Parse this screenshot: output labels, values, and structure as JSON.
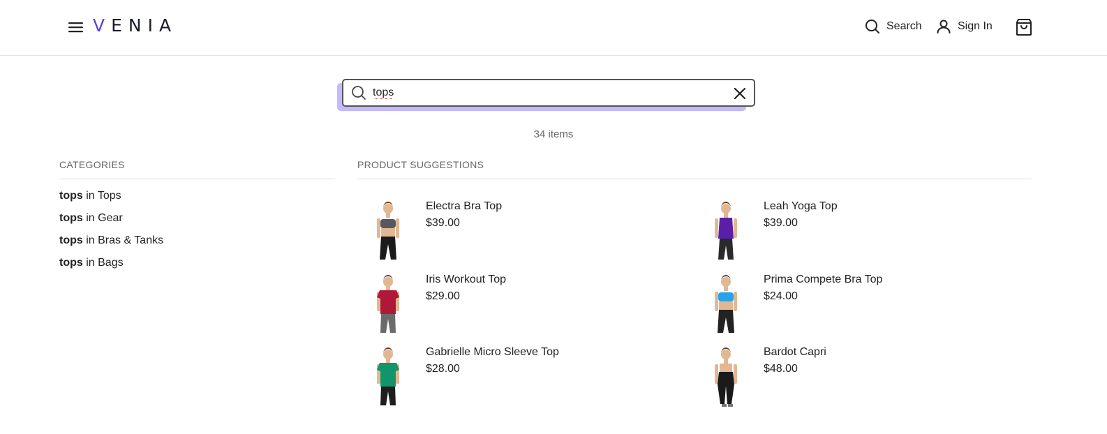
{
  "header": {
    "logo_first": "V",
    "logo_rest": "ENIA",
    "search_label": "Search",
    "signin_label": "Sign In"
  },
  "search": {
    "value": "tops",
    "placeholder": ""
  },
  "results": {
    "count_text": "34 items"
  },
  "categories": {
    "title": "CATEGORIES",
    "items": [
      {
        "term": "tops",
        "rest": " in Tops"
      },
      {
        "term": "tops",
        "rest": " in Gear"
      },
      {
        "term": "tops",
        "rest": " in Bras & Tanks"
      },
      {
        "term": "tops",
        "rest": " in Bags"
      }
    ]
  },
  "products": {
    "title": "PRODUCT SUGGESTIONS",
    "items": [
      {
        "name": "Electra Bra Top",
        "price": "$39.00",
        "top_color": "#555a60",
        "bottom_color": "#1b1b1b",
        "style": "bra"
      },
      {
        "name": "Leah Yoga Top",
        "price": "$39.00",
        "top_color": "#5a1fa8",
        "bottom_color": "#2a2a2a",
        "style": "tank"
      },
      {
        "name": "Iris Workout Top",
        "price": "$29.00",
        "top_color": "#b0183a",
        "bottom_color": "#6b6b6b",
        "style": "tee"
      },
      {
        "name": "Prima Compete Bra Top",
        "price": "$24.00",
        "top_color": "#2aa2e8",
        "bottom_color": "#222222",
        "style": "bra"
      },
      {
        "name": "Gabrielle Micro Sleeve Top",
        "price": "$28.00",
        "top_color": "#12956a",
        "bottom_color": "#1e1e1e",
        "style": "tee"
      },
      {
        "name": "Bardot Capri",
        "price": "$48.00",
        "top_color": "#1a1a1a",
        "bottom_color": "#1a1a1a",
        "style": "capri"
      }
    ]
  },
  "colors": {
    "accent": "#5b3fe0",
    "search_shadow": "#c5b9ff"
  }
}
